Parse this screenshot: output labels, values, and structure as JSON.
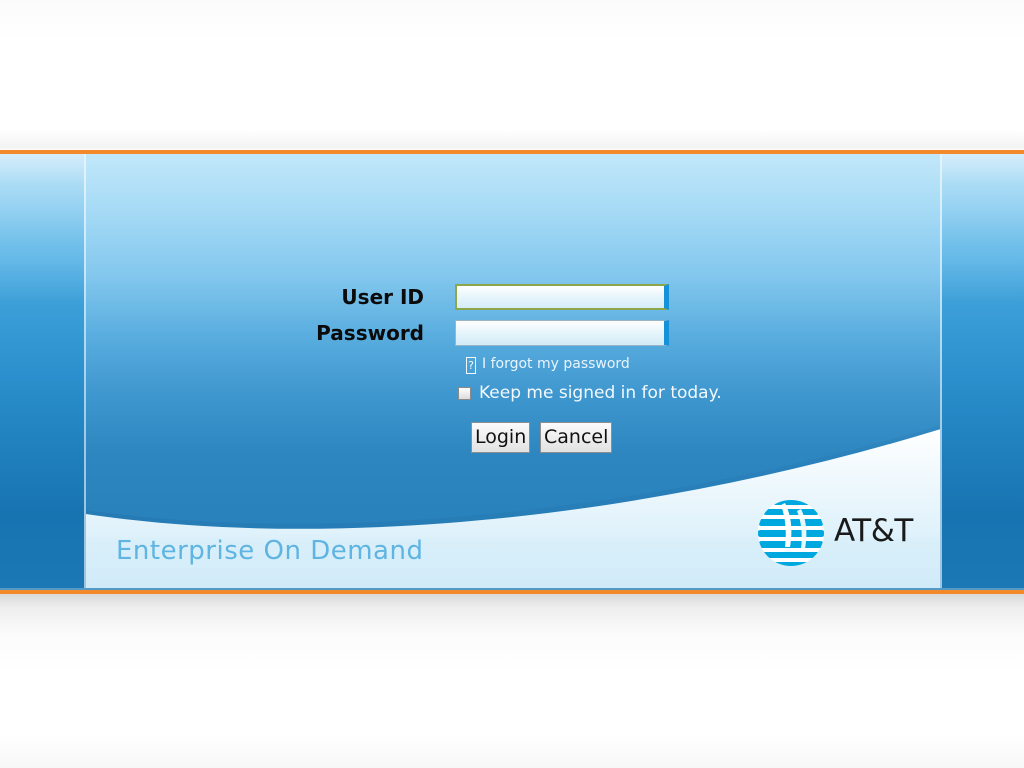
{
  "login": {
    "user_id_label": "User ID",
    "password_label": "Password",
    "user_id_value": "",
    "password_value": "",
    "forgot_password_text": "I forgot my password",
    "forgot_icon_glyph": "?",
    "keep_signed_in_text": "Keep me signed in for today.",
    "keep_signed_in_checked": false,
    "login_button": "Login",
    "cancel_button": "Cancel"
  },
  "branding": {
    "product_name": "Enterprise On Demand",
    "company_name": "AT&T",
    "logo_icon": "att-globe-icon"
  },
  "colors": {
    "accent_orange": "#f28a2c",
    "field_focus_border": "#8ea64a",
    "field_accent": "#1693d8",
    "att_blue": "#00a8e0",
    "product_text": "#5fb4e2"
  }
}
